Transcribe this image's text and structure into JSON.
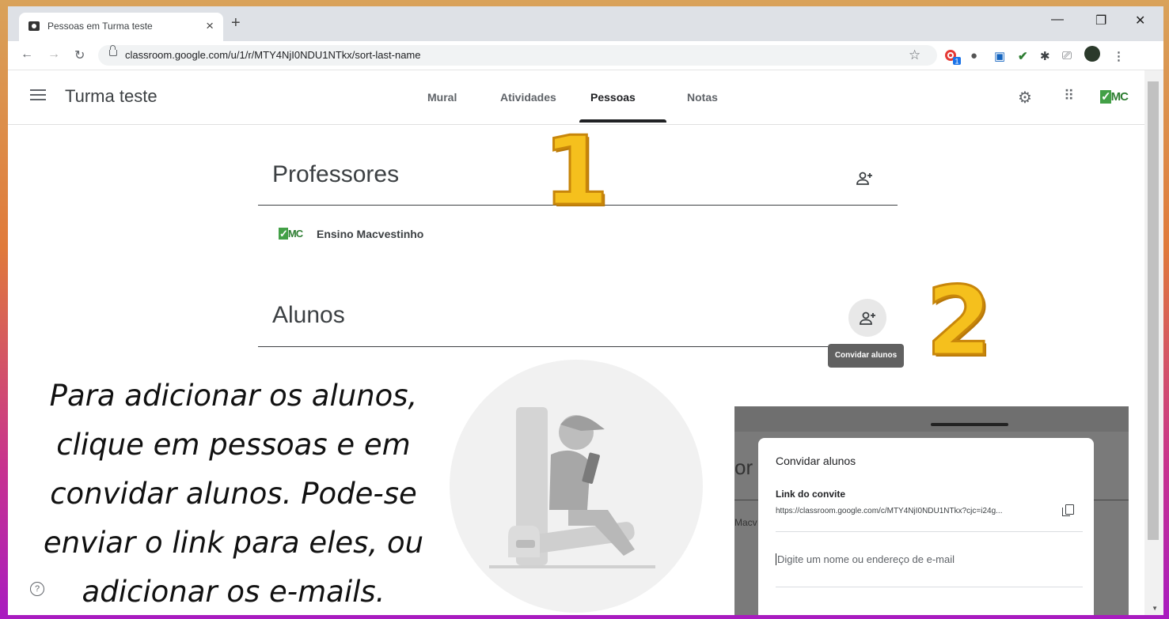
{
  "browser": {
    "tab_title": "Pessoas em Turma teste",
    "tab_close": "×",
    "new_tab": "+",
    "url": "classroom.google.com/u/1/r/MTY4NjI0NDU1NTkx/sort-last-name",
    "ext_badge": "1"
  },
  "header": {
    "class_name": "Turma teste",
    "tabs": [
      "Mural",
      "Atividades",
      "Pessoas",
      "Notas"
    ],
    "active_tab": "Pessoas",
    "logo": "MC"
  },
  "teachers": {
    "title": "Professores",
    "items": [
      {
        "name": "Ensino Macvestinho",
        "logo": "MC"
      }
    ]
  },
  "students": {
    "title": "Alunos",
    "invite_tooltip": "Convidar alunos"
  },
  "annotations": {
    "step1": "1",
    "step2": "2",
    "caption_lines": [
      "Para adicionar os alunos,",
      "clique em pessoas e em",
      "convidar alunos. Pode-se",
      "enviar o link para eles, ou",
      "adicionar os e-mails."
    ]
  },
  "inset": {
    "ghost_title": "or",
    "ghost_name": "Macv",
    "dialog_title": "Convidar alunos",
    "link_label": "Link do convite",
    "link_value": "https://classroom.google.com/c/MTY4NjI0NDU1NTkx?cjc=i24g...",
    "input_placeholder": "Digite um nome ou endereço de e-mail"
  },
  "colors": {
    "accent": "#202124",
    "badge": "#1a73e8",
    "balloon": "#f5c01d"
  }
}
